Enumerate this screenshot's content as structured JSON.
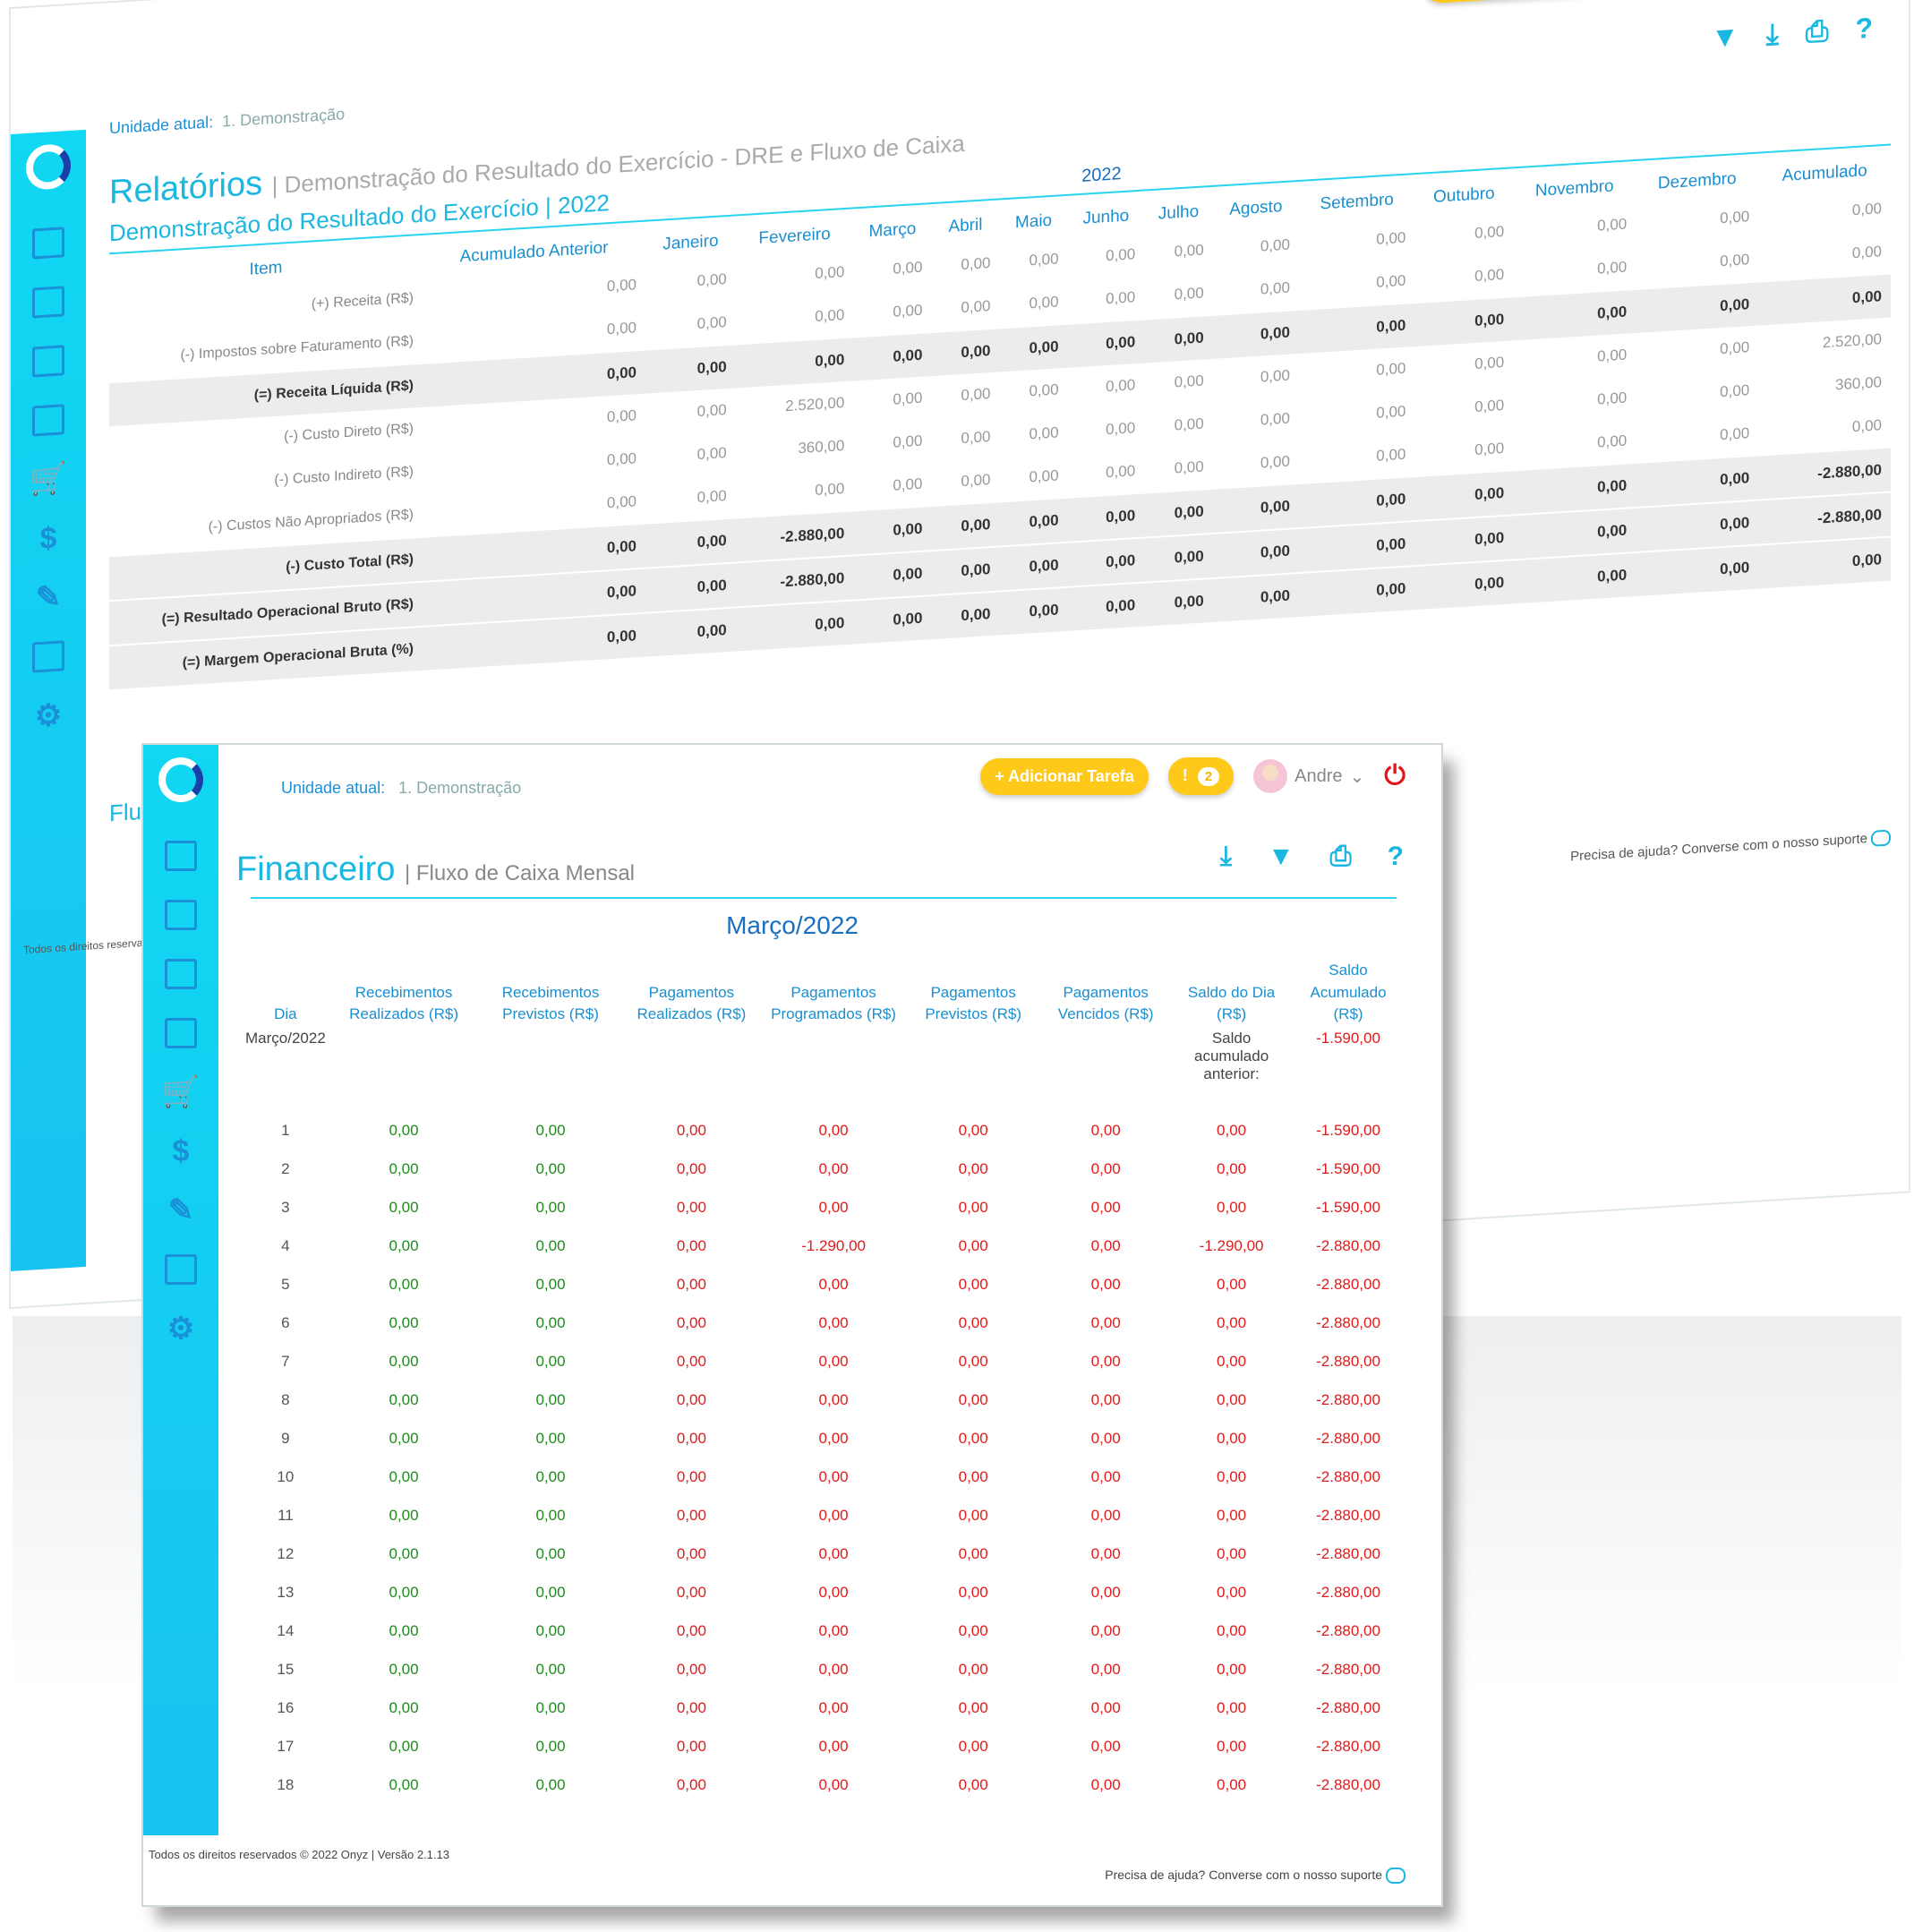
{
  "header": {
    "add_task": "+ Adicionar Tarefa",
    "alert_icon": "!",
    "alert_count": "2",
    "user_name": "Andre",
    "user_caret": "⌄",
    "power_icon": "⏻"
  },
  "unit": {
    "label": "Unidade atual:",
    "value": "1. Demonstração"
  },
  "back": {
    "title": "Relatórios",
    "subtitle": "| Demonstração do Resultado do Exercício - DRE e Fluxo de Caixa",
    "section_title": "Demonstração do Resultado do Exercício | 2022",
    "year": "2022",
    "columns": [
      "Item",
      "Acumulado Anterior",
      "Janeiro",
      "Fevereiro",
      "Março",
      "Abril",
      "Maio",
      "Junho",
      "Julho",
      "Agosto",
      "Setembro",
      "Outubro",
      "Novembro",
      "Dezembro",
      "Acumulado"
    ],
    "rows": [
      {
        "label": "(+) Receita (R$)",
        "total": false,
        "values": [
          "0,00",
          "0,00",
          "0,00",
          "0,00",
          "0,00",
          "0,00",
          "0,00",
          "0,00",
          "0,00",
          "0,00",
          "0,00",
          "0,00",
          "0,00",
          "0,00"
        ]
      },
      {
        "label": "(-) Impostos sobre Faturamento (R$)",
        "total": false,
        "values": [
          "0,00",
          "0,00",
          "0,00",
          "0,00",
          "0,00",
          "0,00",
          "0,00",
          "0,00",
          "0,00",
          "0,00",
          "0,00",
          "0,00",
          "0,00",
          "0,00"
        ]
      },
      {
        "label": "(=) Receita Líquida (R$)",
        "total": true,
        "values": [
          "0,00",
          "0,00",
          "0,00",
          "0,00",
          "0,00",
          "0,00",
          "0,00",
          "0,00",
          "0,00",
          "0,00",
          "0,00",
          "0,00",
          "0,00",
          "0,00"
        ]
      },
      {
        "label": "(-) Custo Direto (R$)",
        "total": false,
        "values": [
          "0,00",
          "0,00",
          "2.520,00",
          "0,00",
          "0,00",
          "0,00",
          "0,00",
          "0,00",
          "0,00",
          "0,00",
          "0,00",
          "0,00",
          "0,00",
          "2.520,00"
        ]
      },
      {
        "label": "(-) Custo Indireto (R$)",
        "total": false,
        "values": [
          "0,00",
          "0,00",
          "360,00",
          "0,00",
          "0,00",
          "0,00",
          "0,00",
          "0,00",
          "0,00",
          "0,00",
          "0,00",
          "0,00",
          "0,00",
          "360,00"
        ]
      },
      {
        "label": "(-) Custos Não Apropriados (R$)",
        "total": false,
        "values": [
          "0,00",
          "0,00",
          "0,00",
          "0,00",
          "0,00",
          "0,00",
          "0,00",
          "0,00",
          "0,00",
          "0,00",
          "0,00",
          "0,00",
          "0,00",
          "0,00"
        ]
      },
      {
        "label": "(-) Custo Total (R$)",
        "total": true,
        "values": [
          "0,00",
          "0,00",
          "-2.880,00",
          "0,00",
          "0,00",
          "0,00",
          "0,00",
          "0,00",
          "0,00",
          "0,00",
          "0,00",
          "0,00",
          "0,00",
          "-2.880,00"
        ]
      },
      {
        "label": "(=) Resultado Operacional Bruto (R$)",
        "total": true,
        "values": [
          "0,00",
          "0,00",
          "-2.880,00",
          "0,00",
          "0,00",
          "0,00",
          "0,00",
          "0,00",
          "0,00",
          "0,00",
          "0,00",
          "0,00",
          "0,00",
          "-2.880,00"
        ]
      },
      {
        "label": "(=) Margem Operacional Bruta (%)",
        "total": true,
        "values": [
          "0,00",
          "0,00",
          "0,00",
          "0,00",
          "0,00",
          "0,00",
          "0,00",
          "0,00",
          "0,00",
          "0,00",
          "0,00",
          "0,00",
          "0,00",
          "0,00"
        ]
      }
    ],
    "flux_label": "Flux",
    "footer_left": "Todos os direitos reservad",
    "footer_right": "Precisa de ajuda? Converse com o nosso suporte"
  },
  "front": {
    "title": "Financeiro",
    "subtitle": "| Fluxo de Caixa Mensal",
    "month": "Março/2022",
    "columns": [
      "Dia",
      "Recebimentos Realizados (R$)",
      "Recebimentos Previstos (R$)",
      "Pagamentos Realizados (R$)",
      "Pagamentos Programados (R$)",
      "Pagamentos Previstos (R$)",
      "Pagamentos Vencidos (R$)",
      "Saldo do Dia (R$)",
      "Saldo Acumulado (R$)"
    ],
    "prev_row": {
      "dia": "Março/2022",
      "label": "Saldo acumulado anterior:",
      "value": "-1.590,00"
    },
    "rows": [
      {
        "dia": "1",
        "rr": "0,00",
        "rp": "0,00",
        "pr": "0,00",
        "pp": "0,00",
        "pv": "0,00",
        "pvc": "0,00",
        "sd": "0,00",
        "sa": "-1.590,00"
      },
      {
        "dia": "2",
        "rr": "0,00",
        "rp": "0,00",
        "pr": "0,00",
        "pp": "0,00",
        "pv": "0,00",
        "pvc": "0,00",
        "sd": "0,00",
        "sa": "-1.590,00"
      },
      {
        "dia": "3",
        "rr": "0,00",
        "rp": "0,00",
        "pr": "0,00",
        "pp": "0,00",
        "pv": "0,00",
        "pvc": "0,00",
        "sd": "0,00",
        "sa": "-1.590,00"
      },
      {
        "dia": "4",
        "rr": "0,00",
        "rp": "0,00",
        "pr": "0,00",
        "pp": "-1.290,00",
        "pv": "0,00",
        "pvc": "0,00",
        "sd": "-1.290,00",
        "sa": "-2.880,00"
      },
      {
        "dia": "5",
        "rr": "0,00",
        "rp": "0,00",
        "pr": "0,00",
        "pp": "0,00",
        "pv": "0,00",
        "pvc": "0,00",
        "sd": "0,00",
        "sa": "-2.880,00"
      },
      {
        "dia": "6",
        "rr": "0,00",
        "rp": "0,00",
        "pr": "0,00",
        "pp": "0,00",
        "pv": "0,00",
        "pvc": "0,00",
        "sd": "0,00",
        "sa": "-2.880,00"
      },
      {
        "dia": "7",
        "rr": "0,00",
        "rp": "0,00",
        "pr": "0,00",
        "pp": "0,00",
        "pv": "0,00",
        "pvc": "0,00",
        "sd": "0,00",
        "sa": "-2.880,00"
      },
      {
        "dia": "8",
        "rr": "0,00",
        "rp": "0,00",
        "pr": "0,00",
        "pp": "0,00",
        "pv": "0,00",
        "pvc": "0,00",
        "sd": "0,00",
        "sa": "-2.880,00"
      },
      {
        "dia": "9",
        "rr": "0,00",
        "rp": "0,00",
        "pr": "0,00",
        "pp": "0,00",
        "pv": "0,00",
        "pvc": "0,00",
        "sd": "0,00",
        "sa": "-2.880,00"
      },
      {
        "dia": "10",
        "rr": "0,00",
        "rp": "0,00",
        "pr": "0,00",
        "pp": "0,00",
        "pv": "0,00",
        "pvc": "0,00",
        "sd": "0,00",
        "sa": "-2.880,00"
      },
      {
        "dia": "11",
        "rr": "0,00",
        "rp": "0,00",
        "pr": "0,00",
        "pp": "0,00",
        "pv": "0,00",
        "pvc": "0,00",
        "sd": "0,00",
        "sa": "-2.880,00"
      },
      {
        "dia": "12",
        "rr": "0,00",
        "rp": "0,00",
        "pr": "0,00",
        "pp": "0,00",
        "pv": "0,00",
        "pvc": "0,00",
        "sd": "0,00",
        "sa": "-2.880,00"
      },
      {
        "dia": "13",
        "rr": "0,00",
        "rp": "0,00",
        "pr": "0,00",
        "pp": "0,00",
        "pv": "0,00",
        "pvc": "0,00",
        "sd": "0,00",
        "sa": "-2.880,00"
      },
      {
        "dia": "14",
        "rr": "0,00",
        "rp": "0,00",
        "pr": "0,00",
        "pp": "0,00",
        "pv": "0,00",
        "pvc": "0,00",
        "sd": "0,00",
        "sa": "-2.880,00"
      },
      {
        "dia": "15",
        "rr": "0,00",
        "rp": "0,00",
        "pr": "0,00",
        "pp": "0,00",
        "pv": "0,00",
        "pvc": "0,00",
        "sd": "0,00",
        "sa": "-2.880,00"
      },
      {
        "dia": "16",
        "rr": "0,00",
        "rp": "0,00",
        "pr": "0,00",
        "pp": "0,00",
        "pv": "0,00",
        "pvc": "0,00",
        "sd": "0,00",
        "sa": "-2.880,00"
      },
      {
        "dia": "17",
        "rr": "0,00",
        "rp": "0,00",
        "pr": "0,00",
        "pp": "0,00",
        "pv": "0,00",
        "pvc": "0,00",
        "sd": "0,00",
        "sa": "-2.880,00"
      },
      {
        "dia": "18",
        "rr": "0,00",
        "rp": "0,00",
        "pr": "0,00",
        "pp": "0,00",
        "pv": "0,00",
        "pvc": "0,00",
        "sd": "0,00",
        "sa": "-2.880,00"
      }
    ],
    "footer_left": "Todos os direitos reservados © 2022 Onyz | Versão 2.1.13",
    "footer_right": "Precisa de ajuda? Converse com o nosso suporte"
  },
  "icons": {
    "toolbar": [
      "filter-icon",
      "download-icon",
      "print-icon",
      "help-icon"
    ],
    "sidebar": [
      "presentation-chart-icon",
      "monitor-check-icon",
      "calculator-icon",
      "chart-window-icon",
      "cart-icon",
      "dollar-icon",
      "tag-icon",
      "documents-icon",
      "gear-icon"
    ]
  },
  "colors": {
    "accent": "#1ab7e0",
    "sidebar": "#10d7f2",
    "warning": "#ffc91a",
    "negative": "#e01b1b",
    "positive": "#1e8a1e"
  }
}
